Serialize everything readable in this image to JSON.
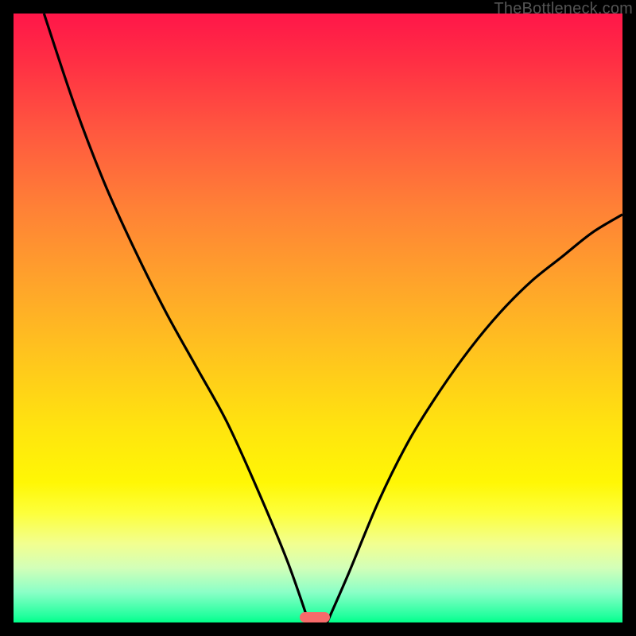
{
  "watermark": "TheBottleneck.com",
  "colors": {
    "frame_bg": "#000000",
    "gradient_top": "#ff1649",
    "gradient_mid1": "#ffa32b",
    "gradient_mid2": "#ffe40f",
    "gradient_bottom": "#00ff88",
    "curve": "#000000",
    "marker": "#f76a6a"
  },
  "chart_data": {
    "type": "line",
    "title": "",
    "xlabel": "",
    "ylabel": "",
    "xlim": [
      0,
      100
    ],
    "ylim": [
      0,
      100
    ],
    "description": "Bottleneck-style V curve: two black curves descending from left and right toward a single minimum near x≈49, over a red→green vertical gradient background. A small red pill marker sits at the minimum.",
    "series": [
      {
        "name": "left-curve",
        "x": [
          5,
          10,
          15,
          20,
          25,
          30,
          35,
          40,
          45,
          48.5
        ],
        "values": [
          100,
          85,
          72,
          61,
          51,
          42,
          33,
          22,
          10,
          0
        ]
      },
      {
        "name": "right-curve",
        "x": [
          51.5,
          55,
          60,
          65,
          70,
          75,
          80,
          85,
          90,
          95,
          100
        ],
        "values": [
          0,
          8,
          20,
          30,
          38,
          45,
          51,
          56,
          60,
          64,
          67
        ]
      }
    ],
    "marker": {
      "x_center": 49.5,
      "y": 0,
      "width_pct": 5
    }
  }
}
